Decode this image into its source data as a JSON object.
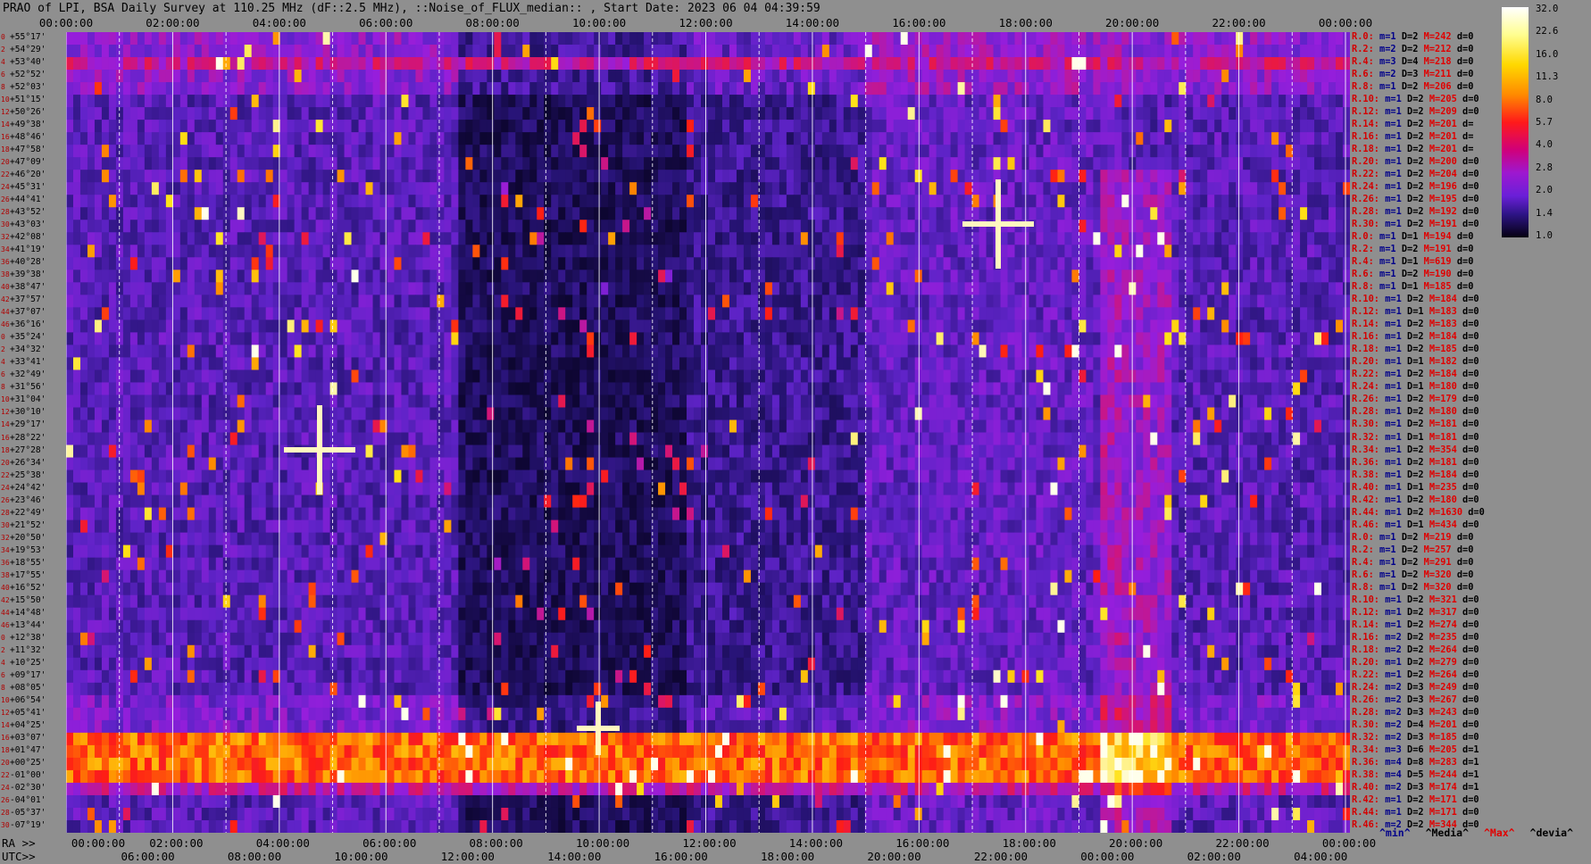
{
  "title": "PRAO of LPI, BSA Daily Survey at 110.25 MHz (dF::2.5 MHz), ::Noise_of_FLUX_median:: , Start Date: 2023 06 04 04:39:59",
  "top_axis_labels": [
    "00:00:00",
    "02:00:00",
    "04:00:00",
    "06:00:00",
    "08:00:00",
    "10:00:00",
    "12:00:00",
    "14:00:00",
    "16:00:00",
    "18:00:00",
    "20:00:00",
    "22:00:00",
    "00:00:00"
  ],
  "bottom_ra": {
    "prefix": "RA >>",
    "labels": [
      "00:00:00",
      "02:00:00",
      "04:00:00",
      "06:00:00",
      "08:00:00",
      "10:00:00",
      "12:00:00",
      "14:00:00",
      "16:00:00",
      "18:00:00",
      "20:00:00",
      "22:00:00",
      "00:00:00"
    ]
  },
  "bottom_utc": {
    "prefix": "UTC>>",
    "labels": [
      "06:00:00",
      "08:00:00",
      "10:00:00",
      "12:00:00",
      "14:00:00",
      "16:00:00",
      "18:00:00",
      "20:00:00",
      "22:00:00",
      "00:00:00",
      "02:00:00",
      "04:00:00"
    ]
  },
  "declinations": [
    "+55°17'",
    "+54°29'",
    "+53°40'",
    "+52°52'",
    "+52°03'",
    "+51°15'",
    "+50°26'",
    "+49°38'",
    "+48°46'",
    "+47°58'",
    "+47°09'",
    "+46°20'",
    "+45°31'",
    "+44°41'",
    "+43°52'",
    "+43°03'",
    "+42°08'",
    "+41°19'",
    "+40°28'",
    "+39°38'",
    "+38°47'",
    "+37°57'",
    "+37°07'",
    "+36°16'",
    "+35°24'",
    "+34°32'",
    "+33°41'",
    "+32°49'",
    "+31°56'",
    "+31°04'",
    "+30°10'",
    "+29°17'",
    "+28°22'",
    "+27°28'",
    "+26°34'",
    "+25°38'",
    "+24°42'",
    "+23°46'",
    "+22°49'",
    "+21°52'",
    "+20°50'",
    "+19°53'",
    "+18°55'",
    "+17°55'",
    "+16°52'",
    "+15°50'",
    "+14°48'",
    "+13°44'",
    "+12°38'",
    "+11°32'",
    "+10°25'",
    "+09°17'",
    "+08°05'",
    "+06°54'",
    "+05°41'",
    "+04°25'",
    "+03°07'",
    "+01°47'",
    "+00°25'",
    "-01°00'",
    "-02°30'",
    "-04°01'",
    "-05°37'",
    "-07°19'"
  ],
  "row_numbers": [
    "0",
    "2",
    "4",
    "6",
    "8",
    "10",
    "12",
    "14",
    "16",
    "18",
    "20",
    "22",
    "24",
    "26",
    "28",
    "30",
    "32",
    "34",
    "36",
    "38",
    "40",
    "42",
    "44",
    "46",
    "0",
    "2",
    "4",
    "6",
    "8",
    "10",
    "12",
    "14",
    "16",
    "18",
    "20",
    "22",
    "24",
    "26",
    "28",
    "30",
    "32",
    "34",
    "36",
    "38",
    "40",
    "42",
    "44",
    "46",
    "0",
    "2",
    "4",
    "6",
    "8",
    "10",
    "12",
    "14",
    "16",
    "18",
    "20",
    "22",
    "24",
    "26",
    "28",
    "30"
  ],
  "right_rows": [
    {
      "r": "R.0:",
      "m": "1",
      "D": "2",
      "M": "242",
      "d": "0"
    },
    {
      "r": "R.2:",
      "m": "2",
      "D": "2",
      "M": "212",
      "d": "0"
    },
    {
      "r": "R.4:",
      "m": "3",
      "D": "4",
      "M": "218",
      "d": "0"
    },
    {
      "r": "R.6:",
      "m": "2",
      "D": "3",
      "M": "211",
      "d": "0"
    },
    {
      "r": "R.8:",
      "m": "1",
      "D": "2",
      "M": "206",
      "d": "0"
    },
    {
      "r": "R.10:",
      "m": "1",
      "D": "2",
      "M": "205",
      "d": "0"
    },
    {
      "r": "R.12:",
      "m": "1",
      "D": "2",
      "M": "209",
      "d": "0"
    },
    {
      "r": "R.14:",
      "m": "1",
      "D": "2",
      "M": "201",
      "d": ""
    },
    {
      "r": "R.16:",
      "m": "1",
      "D": "2",
      "M": "201",
      "d": ""
    },
    {
      "r": "R.18:",
      "m": "1",
      "D": "2",
      "M": "201",
      "d": ""
    },
    {
      "r": "R.20:",
      "m": "1",
      "D": "2",
      "M": "200",
      "d": "0"
    },
    {
      "r": "R.22:",
      "m": "1",
      "D": "2",
      "M": "204",
      "d": "0"
    },
    {
      "r": "R.24:",
      "m": "1",
      "D": "2",
      "M": "196",
      "d": "0"
    },
    {
      "r": "R.26:",
      "m": "1",
      "D": "2",
      "M": "195",
      "d": "0"
    },
    {
      "r": "R.28:",
      "m": "1",
      "D": "2",
      "M": "192",
      "d": "0"
    },
    {
      "r": "R.30:",
      "m": "1",
      "D": "2",
      "M": "191",
      "d": "0"
    },
    {
      "r": "R.0:",
      "m": "1",
      "D": "1",
      "M": "194",
      "d": "0"
    },
    {
      "r": "R.2:",
      "m": "1",
      "D": "2",
      "M": "191",
      "d": "0"
    },
    {
      "r": "R.4:",
      "m": "1",
      "D": "1",
      "M": "619",
      "d": "0"
    },
    {
      "r": "R.6:",
      "m": "1",
      "D": "2",
      "M": "190",
      "d": "0"
    },
    {
      "r": "R.8:",
      "m": "1",
      "D": "1",
      "M": "185",
      "d": "0"
    },
    {
      "r": "R.10:",
      "m": "1",
      "D": "2",
      "M": "184",
      "d": "0"
    },
    {
      "r": "R.12:",
      "m": "1",
      "D": "1",
      "M": "183",
      "d": "0"
    },
    {
      "r": "R.14:",
      "m": "1",
      "D": "2",
      "M": "183",
      "d": "0"
    },
    {
      "r": "R.16:",
      "m": "1",
      "D": "2",
      "M": "184",
      "d": "0"
    },
    {
      "r": "R.18:",
      "m": "1",
      "D": "2",
      "M": "185",
      "d": "0"
    },
    {
      "r": "R.20:",
      "m": "1",
      "D": "1",
      "M": "182",
      "d": "0"
    },
    {
      "r": "R.22:",
      "m": "1",
      "D": "2",
      "M": "184",
      "d": "0"
    },
    {
      "r": "R.24:",
      "m": "1",
      "D": "1",
      "M": "180",
      "d": "0"
    },
    {
      "r": "R.26:",
      "m": "1",
      "D": "2",
      "M": "179",
      "d": "0"
    },
    {
      "r": "R.28:",
      "m": "1",
      "D": "2",
      "M": "180",
      "d": "0"
    },
    {
      "r": "R.30:",
      "m": "1",
      "D": "2",
      "M": "181",
      "d": "0"
    },
    {
      "r": "R.32:",
      "m": "1",
      "D": "1",
      "M": "181",
      "d": "0"
    },
    {
      "r": "R.34:",
      "m": "1",
      "D": "2",
      "M": "354",
      "d": "0"
    },
    {
      "r": "R.36:",
      "m": "1",
      "D": "2",
      "M": "181",
      "d": "0"
    },
    {
      "r": "R.38:",
      "m": "1",
      "D": "2",
      "M": "184",
      "d": "0"
    },
    {
      "r": "R.40:",
      "m": "1",
      "D": "1",
      "M": "235",
      "d": "0"
    },
    {
      "r": "R.42:",
      "m": "1",
      "D": "2",
      "M": "180",
      "d": "0"
    },
    {
      "r": "R.44:",
      "m": "1",
      "D": "2",
      "M": "1630",
      "d": "0"
    },
    {
      "r": "R.46:",
      "m": "1",
      "D": "1",
      "M": "434",
      "d": "0"
    },
    {
      "r": "R.0:",
      "m": "1",
      "D": "2",
      "M": "219",
      "d": "0"
    },
    {
      "r": "R.2:",
      "m": "1",
      "D": "2",
      "M": "257",
      "d": "0"
    },
    {
      "r": "R.4:",
      "m": "1",
      "D": "2",
      "M": "291",
      "d": "0"
    },
    {
      "r": "R.6:",
      "m": "1",
      "D": "2",
      "M": "320",
      "d": "0"
    },
    {
      "r": "R.8:",
      "m": "1",
      "D": "2",
      "M": "320",
      "d": "0"
    },
    {
      "r": "R.10:",
      "m": "1",
      "D": "2",
      "M": "321",
      "d": "0"
    },
    {
      "r": "R.12:",
      "m": "1",
      "D": "2",
      "M": "317",
      "d": "0"
    },
    {
      "r": "R.14:",
      "m": "1",
      "D": "2",
      "M": "274",
      "d": "0"
    },
    {
      "r": "R.16:",
      "m": "2",
      "D": "2",
      "M": "235",
      "d": "0"
    },
    {
      "r": "R.18:",
      "m": "2",
      "D": "2",
      "M": "264",
      "d": "0"
    },
    {
      "r": "R.20:",
      "m": "1",
      "D": "2",
      "M": "279",
      "d": "0"
    },
    {
      "r": "R.22:",
      "m": "1",
      "D": "2",
      "M": "264",
      "d": "0"
    },
    {
      "r": "R.24:",
      "m": "2",
      "D": "3",
      "M": "249",
      "d": "0"
    },
    {
      "r": "R.26:",
      "m": "2",
      "D": "3",
      "M": "267",
      "d": "0"
    },
    {
      "r": "R.28:",
      "m": "2",
      "D": "3",
      "M": "243",
      "d": "0"
    },
    {
      "r": "R.30:",
      "m": "2",
      "D": "4",
      "M": "201",
      "d": "0"
    },
    {
      "r": "R.32:",
      "m": "2",
      "D": "3",
      "M": "185",
      "d": "0"
    },
    {
      "r": "R.34:",
      "m": "3",
      "D": "6",
      "M": "205",
      "d": "1"
    },
    {
      "r": "R.36:",
      "m": "4",
      "D": "8",
      "M": "283",
      "d": "1"
    },
    {
      "r": "R.38:",
      "m": "4",
      "D": "5",
      "M": "244",
      "d": "1"
    },
    {
      "r": "R.40:",
      "m": "2",
      "D": "3",
      "M": "174",
      "d": "1"
    },
    {
      "r": "R.42:",
      "m": "1",
      "D": "2",
      "M": "171",
      "d": "0"
    },
    {
      "r": "R.44:",
      "m": "1",
      "D": "2",
      "M": "171",
      "d": "0"
    },
    {
      "r": "R.46:",
      "m": "2",
      "D": "2",
      "M": "344",
      "d": "0"
    }
  ],
  "right_keys": {
    "m": "m=",
    "D": "D=",
    "M": "M=",
    "d": "d="
  },
  "legend": {
    "min": "^min^",
    "median": "^Media^",
    "max": "^Max^",
    "dev": "^devia^"
  },
  "colorbar_ticks": [
    "32.0",
    "22.6",
    "16.0",
    "11.3",
    "8.0",
    "5.7",
    "4.0",
    "2.8",
    "2.0",
    "1.4",
    "1.0"
  ],
  "colors": {
    "min": "#00008a",
    "median": "#000000",
    "max": "#e00000",
    "dev": "#000000"
  },
  "chart_data": {
    "type": "heatmap",
    "title": "PRAO of LPI, BSA Daily Survey at 110.25 MHz (dF::2.5 MHz), ::Noise_of_FLUX_median:: , Start Date: 2023 06 04 04:39:59",
    "x_axis_top": "RA 00:00:00 – 00:00:00 (2 h ticks)",
    "y_axis": "Declination +55°17' to -07°19' (64 beams)",
    "colormap": "gnuplot-like (black-blue-purple-red-orange-yellow-white)",
    "color_scale_ticks": [
      32.0,
      22.6,
      16.0,
      11.3,
      8.0,
      5.7,
      4.0,
      2.8,
      2.0,
      1.4,
      1.0
    ],
    "color_range": [
      1.0,
      32.0
    ],
    "scale": "log"
  }
}
